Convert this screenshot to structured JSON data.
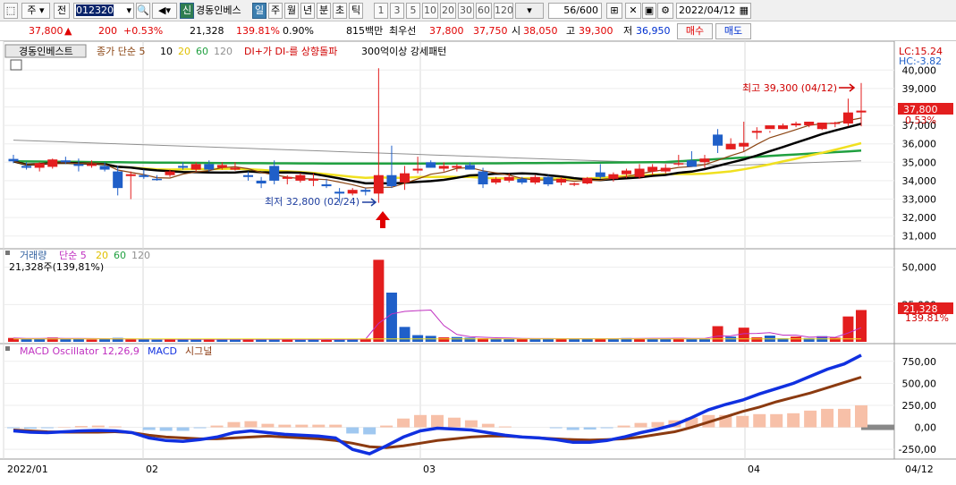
{
  "toolbar": {
    "type_label": "주",
    "prev_label": "전",
    "code": "012320",
    "stock_name": "경동인베스",
    "credit_label": "신",
    "period_tabs": [
      "일",
      "주",
      "월",
      "년",
      "분",
      "초",
      "틱"
    ],
    "active_period": "일",
    "intervals": [
      "1",
      "3",
      "5",
      "10",
      "20",
      "30",
      "60",
      "120"
    ],
    "count": "56",
    "count_total": "/600",
    "date": "2022/04/12"
  },
  "quote": {
    "price": "37,800",
    "change": "200",
    "change_pct": "+0.53%",
    "volume": "21,328",
    "volume_ratio": "139.81%",
    "turnover": "0.90%",
    "amount": "815백만",
    "best_label": "최우선",
    "best_bid": "37,800",
    "best_ask": "37,750",
    "open_label": "시",
    "open": "38,050",
    "high_label": "고",
    "high": "39,300",
    "low_label": "저",
    "low": "36,950",
    "buy_label": "매수",
    "sell_label": "매도"
  },
  "legend": {
    "name": "경동인베스트",
    "ma_label": "종가 단순 5",
    "ma_periods": [
      "10",
      "20",
      "60",
      "120"
    ],
    "signal1": "DI+가 DI-를 상향돌파",
    "signal2": "300억이상 강세패턴",
    "volume_label": "거래량",
    "volume_ma_label": "단순 5",
    "volume_value": "21,328주(139,81%)",
    "macd_label": "MACD Oscillator 12,26,9",
    "macd_line_label": "MACD",
    "signal_line_label": "시그널"
  },
  "price_panel": {
    "lc": "LC:15.24",
    "hc": "HC:-3.82",
    "current_tag": "37,800",
    "current_pct": "0.53%",
    "high_annotation": "최고 39,300 (04/12)",
    "low_annotation": "최저 32,800 (02/24)"
  },
  "volume_panel": {
    "current_tag": "21,328",
    "current_pct": "139.81%"
  },
  "x_labels": [
    "2022/01",
    "02",
    "03",
    "04",
    "04/12"
  ],
  "colors": {
    "up": "#e31e1e",
    "down": "#1f5fc8",
    "ma5": "#8b4513",
    "ma10": "#000000",
    "ma20": "#f0e020",
    "ma60": "#20a040",
    "ma120": "#909090",
    "macd": "#1030e0",
    "signal": "#8b3a10",
    "osc_pos": "#f7c0a8",
    "osc_neg": "#a0c8f0",
    "vol_ma": "#c030c0"
  },
  "chart_data": {
    "type": "candlestick",
    "ohlc": [
      [
        35180,
        35400,
        34950,
        35050
      ],
      [
        34800,
        35000,
        34600,
        34700
      ],
      [
        34700,
        35000,
        34500,
        34950
      ],
      [
        34750,
        35200,
        34650,
        35150
      ],
      [
        35100,
        35300,
        34900,
        35000
      ],
      [
        34900,
        35200,
        34500,
        34800
      ],
      [
        34800,
        35100,
        34700,
        34900
      ],
      [
        34800,
        35000,
        34500,
        34600
      ],
      [
        34500,
        34800,
        33200,
        33600
      ],
      [
        34250,
        34500,
        33000,
        34350
      ],
      [
        34300,
        34600,
        34100,
        34200
      ],
      [
        34100,
        34300,
        34000,
        34050
      ],
      [
        34300,
        34600,
        34200,
        34500
      ],
      [
        34800,
        35000,
        34600,
        34700
      ],
      [
        34600,
        35000,
        34500,
        34900
      ],
      [
        34900,
        35100,
        34500,
        34600
      ],
      [
        34700,
        35000,
        34600,
        34850
      ],
      [
        34600,
        35000,
        34550,
        34700
      ],
      [
        34300,
        34500,
        34000,
        34200
      ],
      [
        34000,
        34200,
        33600,
        33850
      ],
      [
        34800,
        35100,
        33800,
        34000
      ],
      [
        34100,
        34300,
        33800,
        34200
      ],
      [
        34000,
        34400,
        33900,
        34300
      ],
      [
        34000,
        34400,
        33700,
        34100
      ],
      [
        33800,
        34100,
        33600,
        33700
      ],
      [
        33400,
        33600,
        32800,
        33300
      ],
      [
        33300,
        33600,
        33200,
        33500
      ],
      [
        33500,
        33600,
        33200,
        33400
      ],
      [
        33300,
        40100,
        32800,
        34300
      ],
      [
        34300,
        35900,
        33600,
        33700
      ],
      [
        33900,
        34800,
        33500,
        34400
      ],
      [
        34550,
        35300,
        34400,
        34650
      ],
      [
        35000,
        35100,
        34700,
        34700
      ],
      [
        34650,
        35000,
        34500,
        34800
      ],
      [
        34700,
        34900,
        34500,
        34800
      ],
      [
        34850,
        35000,
        34600,
        34600
      ],
      [
        34500,
        34700,
        33600,
        33800
      ],
      [
        33900,
        34200,
        33800,
        34100
      ],
      [
        34000,
        34400,
        33900,
        34200
      ],
      [
        34100,
        34200,
        33800,
        33900
      ],
      [
        33900,
        34300,
        33800,
        34200
      ],
      [
        34200,
        34300,
        33700,
        33800
      ],
      [
        33900,
        34200,
        33750,
        34100
      ],
      [
        33800,
        33900,
        33700,
        33850
      ],
      [
        33850,
        34200,
        33800,
        34150
      ],
      [
        34450,
        34900,
        34100,
        34200
      ],
      [
        34100,
        34450,
        33950,
        34350
      ],
      [
        34350,
        34650,
        34150,
        34550
      ],
      [
        34200,
        34900,
        34100,
        34650
      ],
      [
        34500,
        34900,
        34300,
        34750
      ],
      [
        34500,
        34900,
        34400,
        34700
      ],
      [
        34950,
        35400,
        34800,
        34950
      ],
      [
        35100,
        35600,
        34800,
        34750
      ],
      [
        35000,
        35400,
        34700,
        35200
      ],
      [
        36500,
        36800,
        35500,
        35900
      ],
      [
        35700,
        36300,
        35700,
        36000
      ]
    ],
    "tail_ohlc": [
      [
        35850,
        37200,
        35600,
        36050
      ],
      [
        36600,
        36900,
        36250,
        36700
      ],
      [
        36800,
        36700,
        36600,
        37000
      ],
      [
        36800,
        37100,
        36800,
        37000
      ],
      [
        37000,
        37200,
        36900,
        37100
      ],
      [
        37000,
        37200,
        36900,
        37200
      ],
      [
        36800,
        37100,
        36750,
        37150
      ],
      [
        37100,
        37200,
        36900,
        37150
      ],
      [
        37100,
        38450,
        36950,
        37700
      ],
      [
        37700,
        39300,
        36950,
        37800
      ]
    ],
    "volume": [
      2600,
      2000,
      2100,
      2900,
      1800,
      2300,
      1600,
      1800,
      2600,
      1700,
      1600,
      1400,
      1500,
      1800,
      1700,
      1900,
      1600,
      1500,
      1700,
      1800,
      1500,
      1500,
      1400,
      1900,
      1300,
      1800,
      1700,
      2200,
      55000,
      33000,
      10000,
      4500,
      4000,
      3000,
      3200,
      2800,
      2400,
      2200,
      2100,
      2000,
      2100,
      2300,
      2100,
      1900,
      2000,
      2200,
      2300,
      2500,
      2300,
      2400,
      2100,
      2600,
      2100,
      1800,
      10500,
      3500,
      9500,
      3000,
      4200,
      2400,
      3500,
      2500,
      3800,
      2800,
      17000,
      21328
    ],
    "macd": [
      -40,
      -55,
      -60,
      -50,
      -40,
      -35,
      -40,
      -60,
      -120,
      -150,
      -160,
      -140,
      -110,
      -60,
      -40,
      -60,
      -80,
      -90,
      -100,
      -120,
      -250,
      -300,
      -210,
      -110,
      -40,
      -10,
      -20,
      -30,
      -60,
      -90,
      -110,
      -120,
      -140,
      -170,
      -170,
      -150,
      -110,
      -60,
      -20,
      30,
      110,
      200,
      260,
      310,
      380,
      440,
      500,
      580,
      660,
      720,
      820
    ],
    "signal": [
      -30,
      -40,
      -50,
      -55,
      -55,
      -55,
      -50,
      -60,
      -90,
      -110,
      -120,
      -130,
      -130,
      -120,
      -110,
      -100,
      -110,
      -120,
      -130,
      -150,
      -180,
      -220,
      -230,
      -210,
      -180,
      -150,
      -130,
      -110,
      -100,
      -100,
      -110,
      -120,
      -130,
      -140,
      -145,
      -140,
      -130,
      -110,
      -80,
      -50,
      0,
      60,
      120,
      180,
      230,
      290,
      340,
      390,
      450,
      510,
      570
    ],
    "oscillator": [
      -10,
      -15,
      -10,
      5,
      15,
      20,
      10,
      0,
      -30,
      -40,
      -40,
      -10,
      20,
      60,
      70,
      40,
      30,
      30,
      30,
      30,
      -70,
      -80,
      20,
      100,
      140,
      140,
      110,
      80,
      40,
      10,
      0,
      0,
      -10,
      -30,
      -25,
      -10,
      20,
      50,
      60,
      80,
      110,
      140,
      140,
      130,
      150,
      150,
      160,
      190,
      210,
      210,
      250
    ],
    "price_ylim": [
      30500,
      40500
    ],
    "volume_ylim": [
      0,
      60000
    ],
    "macd_ylim": [
      -350,
      900
    ]
  }
}
